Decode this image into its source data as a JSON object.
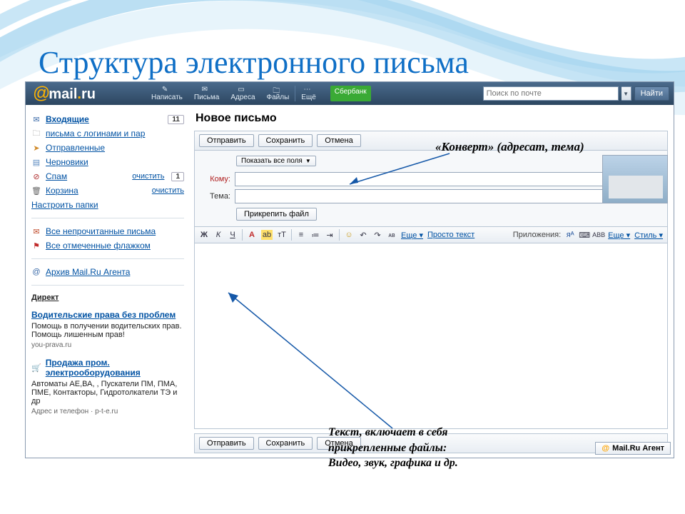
{
  "slide": {
    "title": "Структура электронного письма"
  },
  "logo": {
    "at": "@",
    "mail": "mail",
    "dot": ".",
    "ru": "ru"
  },
  "nav": {
    "write": "Написать",
    "letters": "Письма",
    "addresses": "Адреса",
    "files": "Файлы",
    "more": "Ещё",
    "sberbank": "Сбербанк"
  },
  "search": {
    "placeholder": "Поиск по почте",
    "find": "Найти"
  },
  "sidebar": {
    "inbox": "Входящие",
    "inbox_count": "11",
    "logins": "письма с логинами и пар",
    "sent": "Отправленные",
    "drafts": "Черновики",
    "spam": "Спам",
    "spam_clear": "очистить",
    "spam_count": "1",
    "trash": "Корзина",
    "trash_clear": "очистить",
    "settings": "Настроить папки",
    "unread": "Все непрочитанные письма",
    "flagged": "Все отмеченные флажком",
    "archive": "Архив Mail.Ru Агента",
    "direct": "Директ",
    "ad1_title": "Водительские права без проблем",
    "ad1_body": "Помощь в получении водительских прав. Помощь лишенным прав!",
    "ad1_src": "you-prava.ru",
    "ad2_title": "Продажа пром. электрооборудования",
    "ad2_body": "Автоматы АЕ,ВА, , Пускатели ПМ, ПМА, ПМЕ, Контакторы, Гидротолкатели ТЭ и др",
    "ad2_src": "Адрес и телефон · p-t-e.ru"
  },
  "compose": {
    "title": "Новое письмо",
    "send": "Отправить",
    "save": "Сохранить",
    "cancel": "Отмена",
    "show_all": "Показать все поля",
    "to": "Кому:",
    "subject": "Тема:",
    "attach": "Прикрепить файл",
    "tb_bold": "Ж",
    "tb_italic": "К",
    "tb_uline": "Ч",
    "tb_more": "Еще",
    "tb_plain": "Просто текст",
    "tb_apps": "Приложения:",
    "tb_more2": "Еще",
    "tb_style": "Стиль"
  },
  "callouts": {
    "envelope": "«Конверт» (адресат, тема)",
    "body": "Текст, включает в себя прикрепленные файлы:\nВидео, звук, графика и др."
  },
  "agent": {
    "label": "Mail.Ru Агент"
  }
}
